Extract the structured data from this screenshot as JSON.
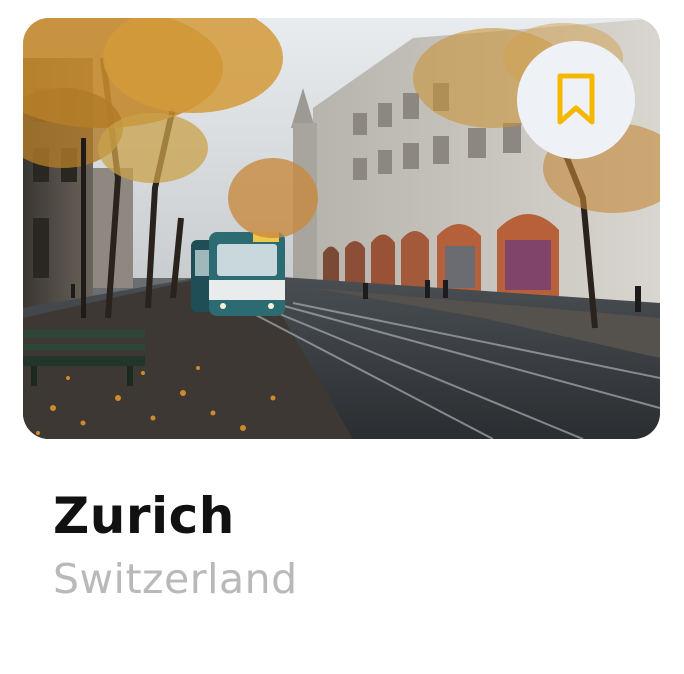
{
  "card": {
    "title": "Zurich",
    "subtitle": "Switzerland"
  },
  "image": {
    "alt": "Tram on a tree-lined street in Zurich in autumn"
  },
  "bookmark": {
    "icon": "bookmark-icon",
    "icon_color": "#f5b800",
    "background": "#eef2f7"
  },
  "colors": {
    "title": "#111111",
    "subtitle": "#b9b9b9"
  }
}
